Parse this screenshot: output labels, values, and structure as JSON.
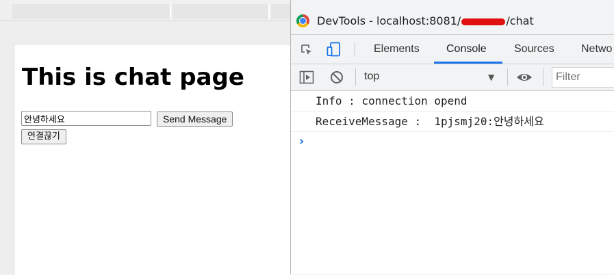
{
  "browser": {
    "page_heading": "This is chat page",
    "message_input_value": "안녕하세요",
    "send_button_label": "Send Message",
    "disconnect_button_label": "연결끊기"
  },
  "devtools": {
    "title_prefix": "DevTools - localhost:8081/",
    "title_suffix": "/chat",
    "tabs": [
      "Elements",
      "Console",
      "Sources",
      "Netwo"
    ],
    "active_tab": "Console",
    "context": "top",
    "filter_placeholder": "Filter",
    "logs": [
      "Info : connection opend",
      "ReceiveMessage :  1pjsmj20:안녕하세요"
    ],
    "prompt": "›",
    "accent_color": "#1a73e8"
  }
}
